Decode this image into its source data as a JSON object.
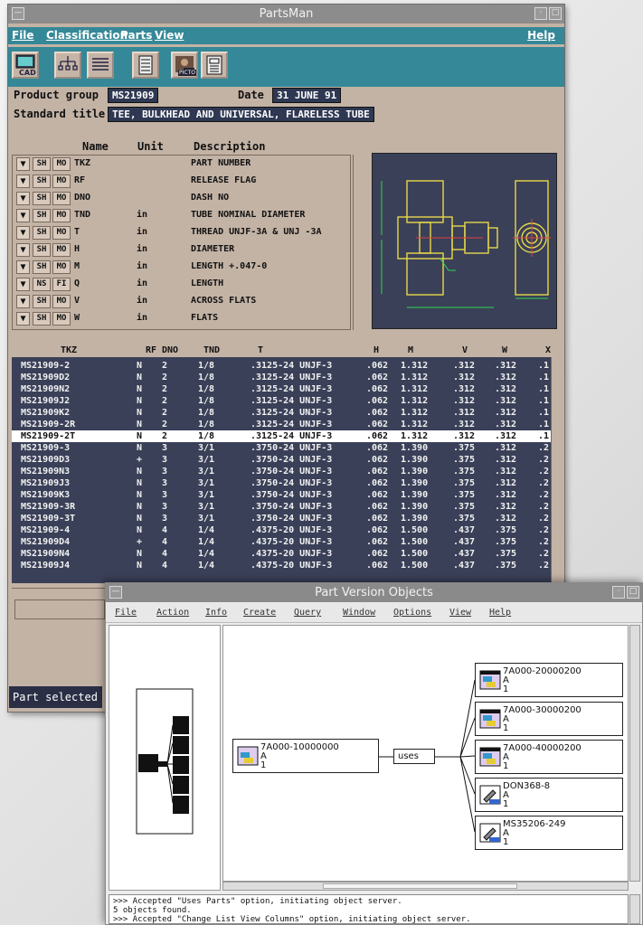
{
  "partsman": {
    "title": "PartsMan",
    "menu": {
      "file": "File",
      "classification": "Classification",
      "parts": "Parts",
      "view": "View",
      "help": "Help"
    },
    "toolbar": {
      "cad": "CAD",
      "picto": "PICTO"
    },
    "product_group_label": "Product group",
    "product_group_value": "MS21909",
    "date_label": "Date",
    "date_value": "31 JUNE 91",
    "standard_title_label": "Standard title",
    "standard_title_value": "TEE, BULKHEAD AND UNIVERSAL, FLARELESS TUBE",
    "param_headers": {
      "name": "Name",
      "unit": "Unit",
      "description": "Description"
    },
    "params": [
      {
        "b1": "SH",
        "b2": "MO",
        "name": "TKZ",
        "unit": "",
        "desc": "PART NUMBER"
      },
      {
        "b1": "SH",
        "b2": "MO",
        "name": "RF",
        "unit": "",
        "desc": "RELEASE FLAG"
      },
      {
        "b1": "SH",
        "b2": "MO",
        "name": "DNO",
        "unit": "",
        "desc": "DASH NO"
      },
      {
        "b1": "SH",
        "b2": "MO",
        "name": "TND",
        "unit": "in",
        "desc": "TUBE NOMINAL DIAMETER"
      },
      {
        "b1": "SH",
        "b2": "MO",
        "name": "T",
        "unit": "in",
        "desc": "THREAD UNJF-3A & UNJ -3A"
      },
      {
        "b1": "SH",
        "b2": "MO",
        "name": "H",
        "unit": "in",
        "desc": "DIAMETER"
      },
      {
        "b1": "SH",
        "b2": "MO",
        "name": "M",
        "unit": "in",
        "desc": "LENGTH +.047-0"
      },
      {
        "b1": "NS",
        "b2": "FI",
        "name": "Q",
        "unit": "in",
        "desc": "LENGTH"
      },
      {
        "b1": "SH",
        "b2": "MO",
        "name": "V",
        "unit": "in",
        "desc": "ACROSS FLATS"
      },
      {
        "b1": "SH",
        "b2": "MO",
        "name": "W",
        "unit": "in",
        "desc": "FLATS"
      }
    ],
    "table_headers": [
      "TKZ",
      "RF",
      "DNO",
      "TND",
      "T",
      "H",
      "M",
      "V",
      "W",
      "X"
    ],
    "rows": [
      [
        "MS21909-2",
        "N",
        "2",
        "1/8",
        ".3125-24 UNJF-3",
        ".062",
        "1.312",
        ".312",
        ".312",
        ".1"
      ],
      [
        "MS21909D2",
        "N",
        "2",
        "1/8",
        ".3125-24 UNJF-3",
        ".062",
        "1.312",
        ".312",
        ".312",
        ".1"
      ],
      [
        "MS21909N2",
        "N",
        "2",
        "1/8",
        ".3125-24 UNJF-3",
        ".062",
        "1.312",
        ".312",
        ".312",
        ".1"
      ],
      [
        "MS21909J2",
        "N",
        "2",
        "1/8",
        ".3125-24 UNJF-3",
        ".062",
        "1.312",
        ".312",
        ".312",
        ".1"
      ],
      [
        "MS21909K2",
        "N",
        "2",
        "1/8",
        ".3125-24 UNJF-3",
        ".062",
        "1.312",
        ".312",
        ".312",
        ".1"
      ],
      [
        "MS21909-2R",
        "N",
        "2",
        "1/8",
        ".3125-24 UNJF-3",
        ".062",
        "1.312",
        ".312",
        ".312",
        ".1"
      ],
      [
        "MS21909-2T",
        "N",
        "2",
        "1/8",
        ".3125-24 UNJF-3",
        ".062",
        "1.312",
        ".312",
        ".312",
        ".1"
      ],
      [
        "MS21909-3",
        "N",
        "3",
        "3/1",
        ".3750-24 UNJF-3",
        ".062",
        "1.390",
        ".375",
        ".312",
        ".2"
      ],
      [
        "MS21909D3",
        "+",
        "3",
        "3/1",
        ".3750-24 UNJF-3",
        ".062",
        "1.390",
        ".375",
        ".312",
        ".2"
      ],
      [
        "MS21909N3",
        "N",
        "3",
        "3/1",
        ".3750-24 UNJF-3",
        ".062",
        "1.390",
        ".375",
        ".312",
        ".2"
      ],
      [
        "MS21909J3",
        "N",
        "3",
        "3/1",
        ".3750-24 UNJF-3",
        ".062",
        "1.390",
        ".375",
        ".312",
        ".2"
      ],
      [
        "MS21909K3",
        "N",
        "3",
        "3/1",
        ".3750-24 UNJF-3",
        ".062",
        "1.390",
        ".375",
        ".312",
        ".2"
      ],
      [
        "MS21909-3R",
        "N",
        "3",
        "3/1",
        ".3750-24 UNJF-3",
        ".062",
        "1.390",
        ".375",
        ".312",
        ".2"
      ],
      [
        "MS21909-3T",
        "N",
        "3",
        "3/1",
        ".3750-24 UNJF-3",
        ".062",
        "1.390",
        ".375",
        ".312",
        ".2"
      ],
      [
        "MS21909-4",
        "N",
        "4",
        "1/4",
        ".4375-20 UNJF-3",
        ".062",
        "1.500",
        ".437",
        ".375",
        ".2"
      ],
      [
        "MS21909D4",
        "+",
        "4",
        "1/4",
        ".4375-20 UNJF-3",
        ".062",
        "1.500",
        ".437",
        ".375",
        ".2"
      ],
      [
        "MS21909N4",
        "N",
        "4",
        "1/4",
        ".4375-20 UNJF-3",
        ".062",
        "1.500",
        ".437",
        ".375",
        ".2"
      ],
      [
        "MS21909J4",
        "N",
        "4",
        "1/4",
        ".4375-20 UNJF-3",
        ".062",
        "1.500",
        ".437",
        ".375",
        ".2"
      ]
    ],
    "selected_row": 6,
    "status": "Part selected",
    "colors": {
      "menu_bg": "#348897",
      "window_bg": "#c3b3a5",
      "table_bg": "#3a4058",
      "selection": "#ffffff"
    }
  },
  "pvo": {
    "title": "Part Version Objects",
    "menu": [
      "File",
      "Action",
      "Info",
      "Create",
      "Query",
      "Window",
      "Options",
      "View",
      "Help"
    ],
    "root": {
      "id": "7A000-10000000",
      "rev": "A",
      "ver": "1"
    },
    "relation": "uses",
    "children": [
      {
        "id": "7A000-20000200",
        "rev": "A",
        "ver": "1",
        "icon": "part-doc-icon"
      },
      {
        "id": "7A000-30000200",
        "rev": "A",
        "ver": "1",
        "icon": "part-doc-icon"
      },
      {
        "id": "7A000-40000200",
        "rev": "A",
        "ver": "1",
        "icon": "part-doc-icon"
      },
      {
        "id": "DON368-8",
        "rev": "A",
        "ver": "1",
        "icon": "tool-part-icon"
      },
      {
        "id": "MS35206-249",
        "rev": "A",
        "ver": "1",
        "icon": "tool-part-icon"
      }
    ],
    "log": [
      ">>> Accepted \"Uses Parts\" option, initiating object server.",
      "5 objects found.",
      ">>> Accepted \"Change List View Columns\" option, initiating object server."
    ]
  }
}
